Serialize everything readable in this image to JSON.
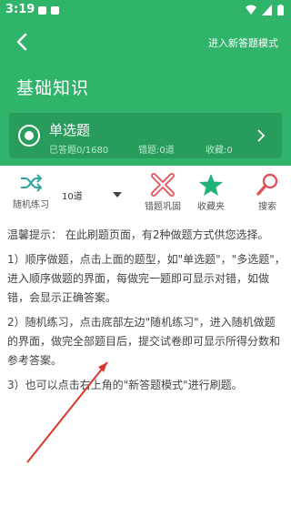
{
  "status": {
    "time": "3:19"
  },
  "header": {
    "mode_link": "进入新答题模式",
    "title": "基础知识"
  },
  "bank": {
    "name": "单选题",
    "answered": "已答题0/1680",
    "wrong": "错题:0道",
    "favorites": "收藏:0"
  },
  "toolbar": {
    "random": "随机练习",
    "count": "10道",
    "wrong_review": "错题巩固",
    "favorites": "收藏夹",
    "search": "搜索"
  },
  "tips": {
    "line1": "温馨提示： 在此刷题页面，有2种做题方式供您选择。",
    "line2": "1）顺序做题，点击上面的题型，如\"单选题\"，\"多选题\"，进入顺序做题的界面，每做完一题即可显示对错，如做错，会显示正确答案。",
    "line3": "2）随机练习，点击底部左边\"随机练习\"，进入随机做题的界面，做完全部题目后，提交试卷即可显示所得分数和参考答案。",
    "line4": "3）也可以点击右上角的\"新答题模式\"进行刷题。"
  },
  "colors": {
    "header_green": "#2fb46a",
    "card_green": "#279c5b",
    "accent_red": "#e0555b",
    "annotation_red": "#d7362f"
  }
}
